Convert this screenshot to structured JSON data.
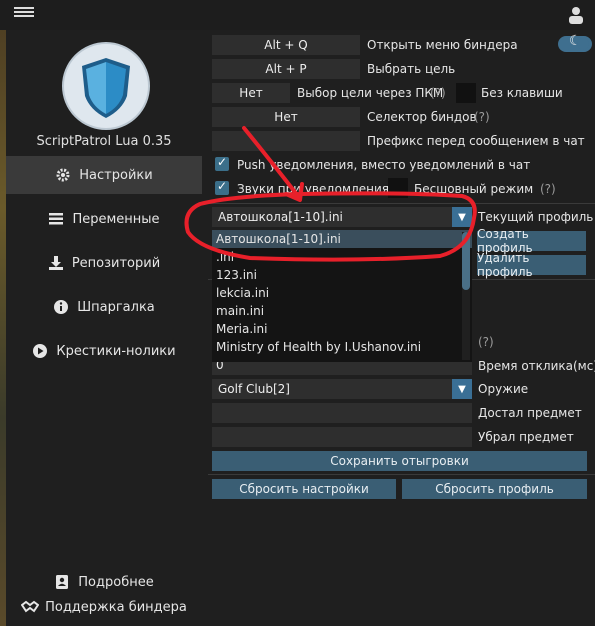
{
  "app": {
    "version": "ScriptPatrol Lua 0.35"
  },
  "sidebar": {
    "items": [
      {
        "label": "Настройки",
        "icon": "gear-icon",
        "active": true
      },
      {
        "label": "Переменные",
        "icon": "list-icon"
      },
      {
        "label": "Репозиторий",
        "icon": "download-icon"
      },
      {
        "label": "Шпаргалка",
        "icon": "info-icon"
      },
      {
        "label": "Крестики-нолики",
        "icon": "play-icon"
      }
    ],
    "bottom": [
      {
        "label": "Подробнее",
        "icon": "contact-icon"
      },
      {
        "label": "Поддержка биндера",
        "icon": "handshake-icon"
      }
    ]
  },
  "settings": {
    "hotkey_open": "Alt + Q",
    "hotkey_open_label": "Открыть меню биндера",
    "hotkey_target": "Alt + P",
    "hotkey_target_label": "Выбрать цель",
    "rmb_value": "Нет",
    "rmb_label": "Выбор цели через ПКМ",
    "q": "(?)",
    "no_key_label": "Без клавиши",
    "selector_value": "Нет",
    "selector_label": "Селектор биндов",
    "prefix_label": "Префикс перед сообщением в чат",
    "push_label": "Push уведомления, вместо уведомлений в чат",
    "sound_label": "Звуки при уведомлениях",
    "silent_label": "Бесшовный режим",
    "profile_value": "Автошкола[1-10].ini",
    "profile_label": "Текущий профиль",
    "create_profile": "Создать профиль",
    "delete_profile": "Удалить профиль",
    "response_label": "Время отклика(мс)",
    "response_value": "0",
    "weapon_value": "Golf Club[2]",
    "weapon_label": "Оружие",
    "took_label": "Достал предмет",
    "put_label": "Убрал предмет",
    "save_rp": "Сохранить отыгровки",
    "reset_settings": "Сбросить настройки",
    "reset_profile": "Сбросить профиль"
  },
  "dropdown": {
    "options": [
      "Автошкола[1-10].ini",
      ".ini",
      "123.ini",
      "lekcia.ini",
      "main.ini",
      "Meria.ini",
      "Ministry of Health by I.Ushanov.ini"
    ],
    "selected": "Автошкола[1-10].ini"
  },
  "colors": {
    "accent": "#3a5e74",
    "annotation": "#e8202a"
  }
}
